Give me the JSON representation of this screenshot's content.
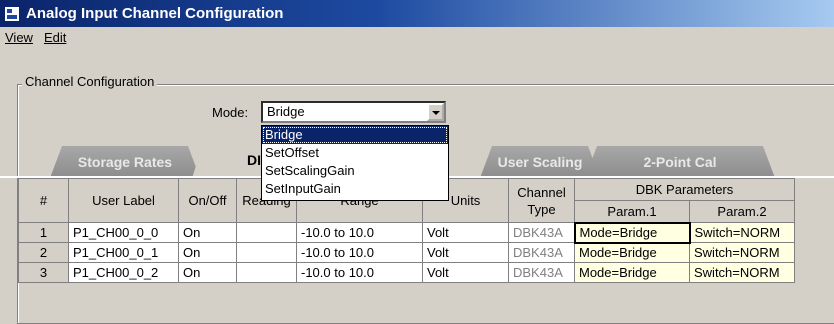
{
  "window": {
    "title": "Analog Input Channel Configuration"
  },
  "menu": {
    "view": "View",
    "edit": "Edit"
  },
  "group": {
    "label": "Channel Configuration"
  },
  "mode": {
    "label": "Mode:",
    "value": "Bridge",
    "options": [
      "Bridge",
      "SetOffset",
      "SetScalingGain",
      "SetInputGain"
    ],
    "highlighted": "Bridge"
  },
  "tabs": [
    {
      "label": "Storage Rates",
      "active": false
    },
    {
      "label": "DI",
      "active": true
    },
    {
      "label": "User Scaling",
      "active": false
    },
    {
      "label": "2-Point Cal",
      "active": false
    }
  ],
  "table": {
    "headers": {
      "num": "#",
      "user_label": "User Label",
      "onoff": "On/Off",
      "reading": "Reading",
      "range": "Range",
      "units": "Units",
      "channel_type": "Channel Type",
      "dbk_params": "DBK Parameters",
      "param1": "Param.1",
      "param2": "Param.2"
    },
    "rows": [
      {
        "num": "1",
        "label": "P1_CH00_0_0",
        "onoff": "On",
        "reading": "",
        "range": "-10.0 to 10.0",
        "units": "Volt",
        "type": "DBK43A",
        "param1": "Mode=Bridge",
        "param2": "Switch=NORM"
      },
      {
        "num": "2",
        "label": "P1_CH00_0_1",
        "onoff": "On",
        "reading": "",
        "range": "-10.0 to 10.0",
        "units": "Volt",
        "type": "DBK43A",
        "param1": "Mode=Bridge",
        "param2": "Switch=NORM"
      },
      {
        "num": "3",
        "label": "P1_CH00_0_2",
        "onoff": "On",
        "reading": "",
        "range": "-10.0 to 10.0",
        "units": "Volt",
        "type": "DBK43A",
        "param1": "Mode=Bridge",
        "param2": "Switch=NORM"
      }
    ]
  }
}
